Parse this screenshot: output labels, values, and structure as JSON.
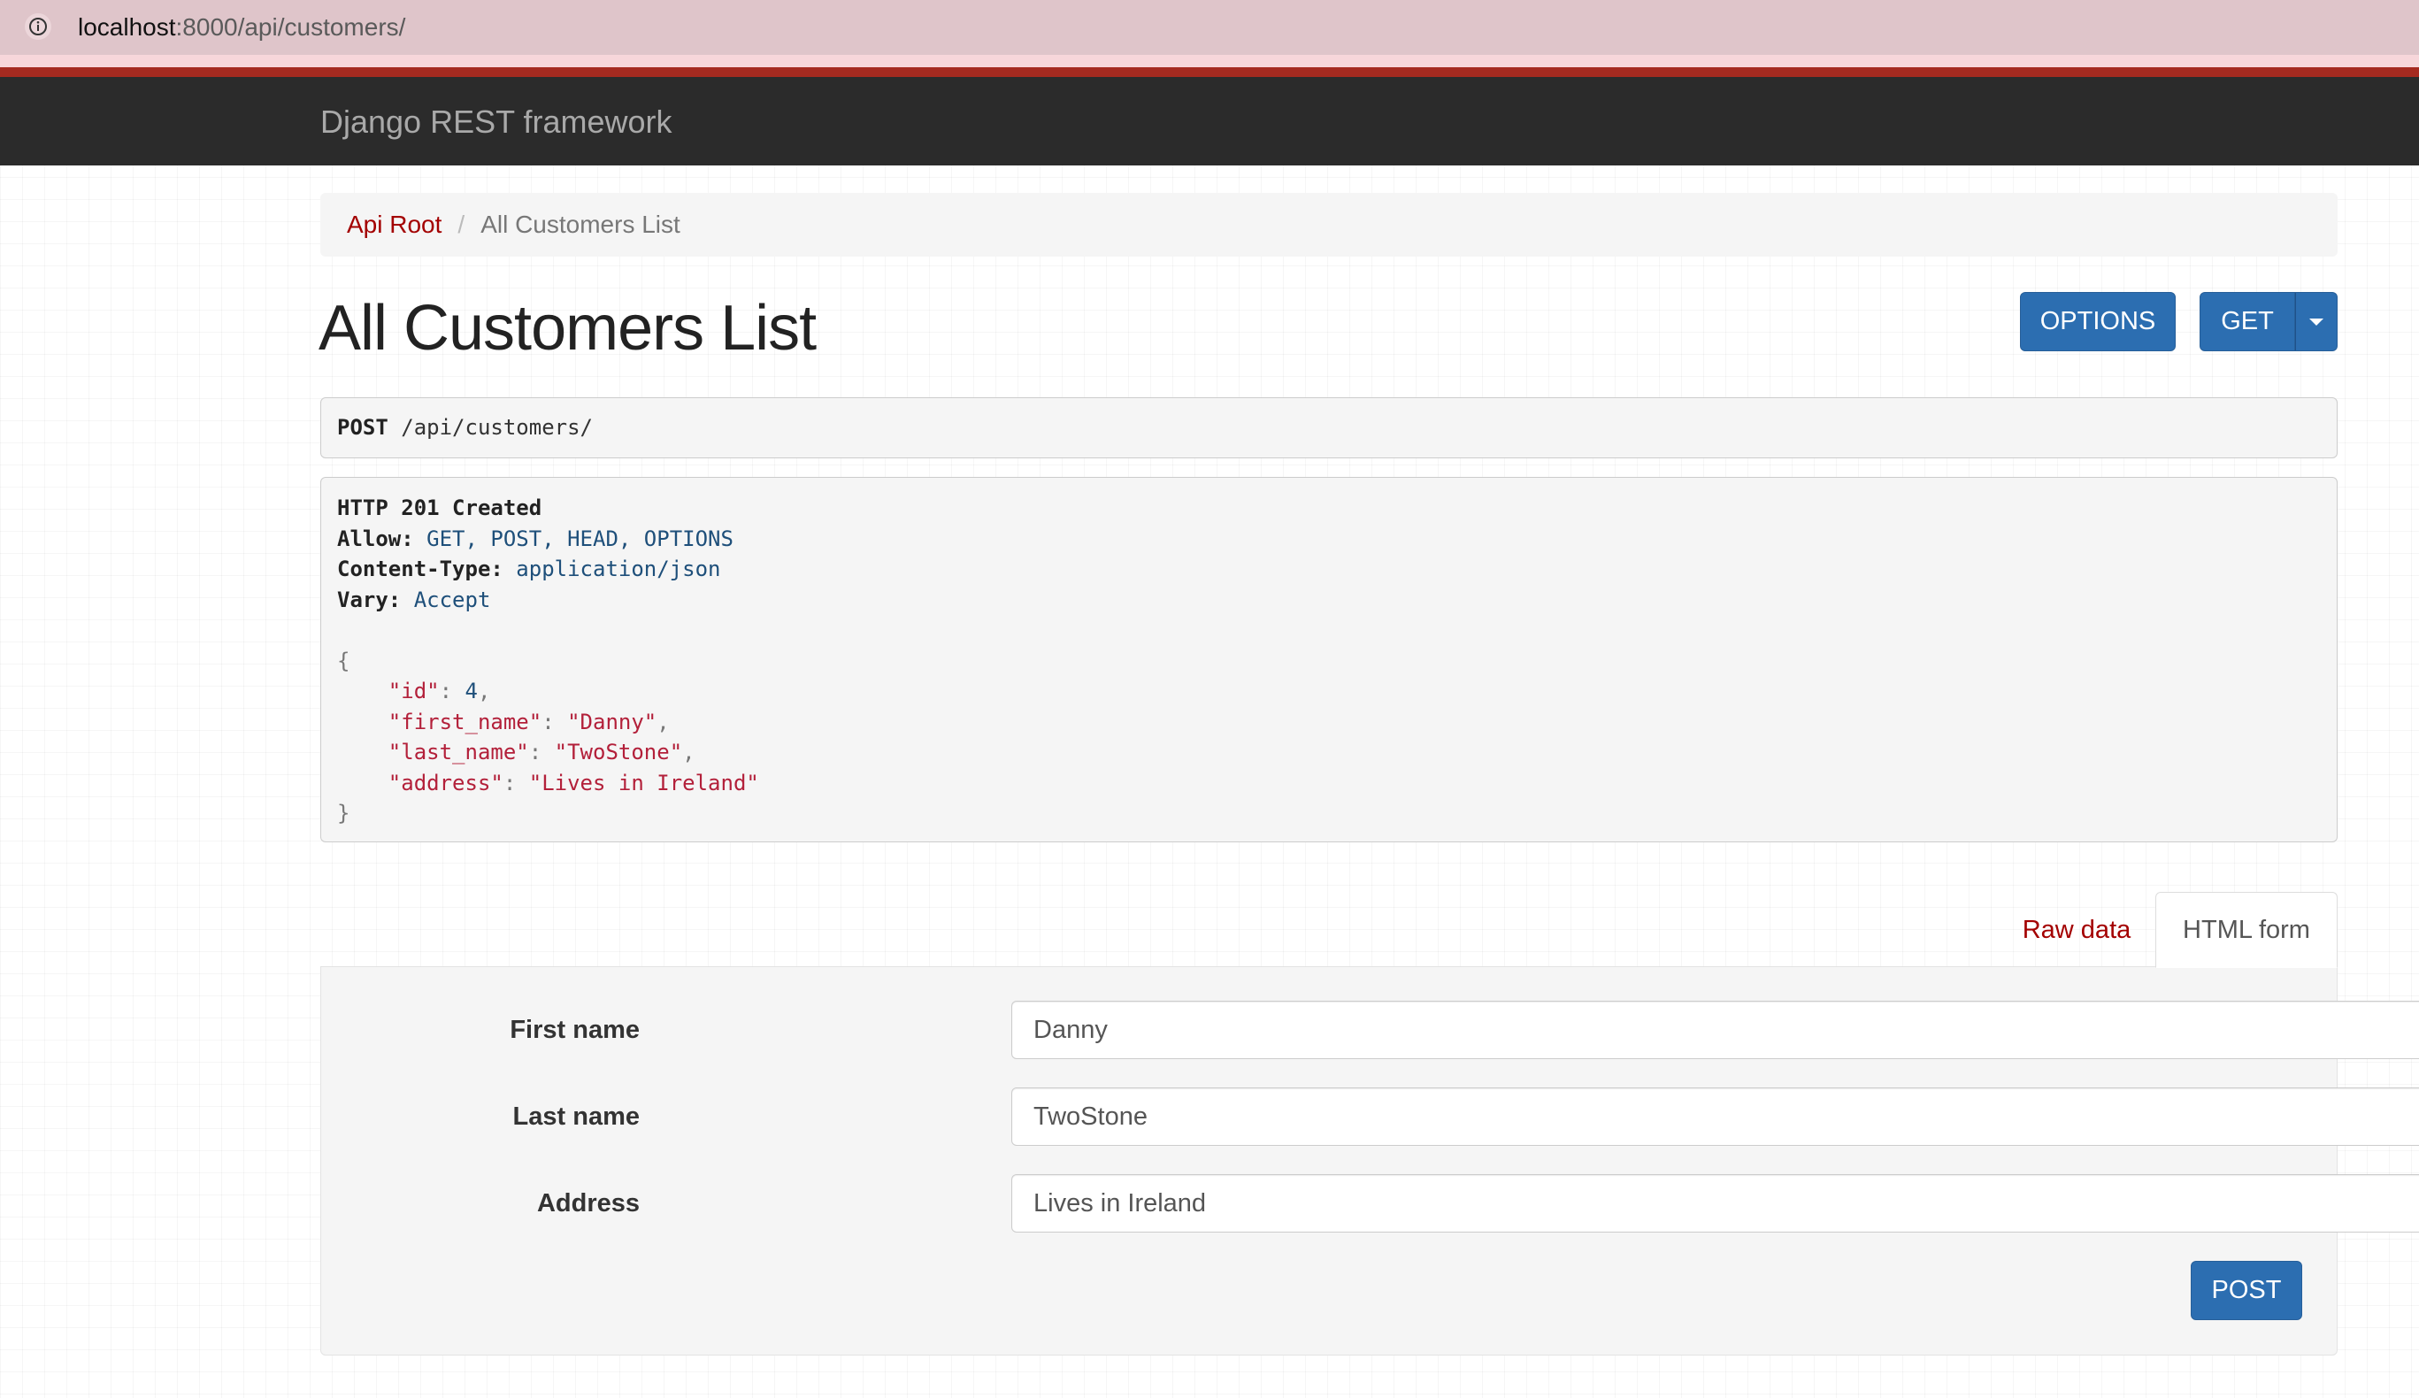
{
  "browser": {
    "url_host": "localhost",
    "url_rest": ":8000/api/customers/"
  },
  "navbar": {
    "brand": "Django REST framework"
  },
  "breadcrumb": {
    "root_label": "Api Root",
    "separator": "/",
    "current_label": "All Customers List"
  },
  "page": {
    "title": "All Customers List"
  },
  "toolbar": {
    "options_label": "OPTIONS",
    "get_label": "GET"
  },
  "request": {
    "method": "POST",
    "path": " /api/customers/"
  },
  "response": {
    "status": "HTTP 201 Created",
    "headers": [
      {
        "name": "Allow:",
        "value": " GET, POST, HEAD, OPTIONS"
      },
      {
        "name": "Content-Type:",
        "value": " application/json"
      },
      {
        "name": "Vary:",
        "value": " Accept"
      }
    ],
    "body": {
      "open": "{",
      "close": "}",
      "fields": [
        {
          "key": "\"id\"",
          "value": "4",
          "type": "number",
          "comma": ","
        },
        {
          "key": "\"first_name\"",
          "value": "\"Danny\"",
          "type": "string",
          "comma": ","
        },
        {
          "key": "\"last_name\"",
          "value": "\"TwoStone\"",
          "type": "string",
          "comma": ","
        },
        {
          "key": "\"address\"",
          "value": "\"Lives in Ireland\"",
          "type": "string",
          "comma": ""
        }
      ]
    }
  },
  "tabs": {
    "raw_label": "Raw data",
    "html_label": "HTML form",
    "active": "HTML form"
  },
  "form": {
    "fields": [
      {
        "label": "First name",
        "value": "Danny"
      },
      {
        "label": "Last name",
        "value": "TwoStone"
      },
      {
        "label": "Address",
        "value": "Lives in Ireland"
      }
    ],
    "submit_label": "POST"
  },
  "colors": {
    "navbar_bg": "#2b2b2b",
    "accent_red": "#a30000",
    "button_blue": "#2c6eb1"
  }
}
